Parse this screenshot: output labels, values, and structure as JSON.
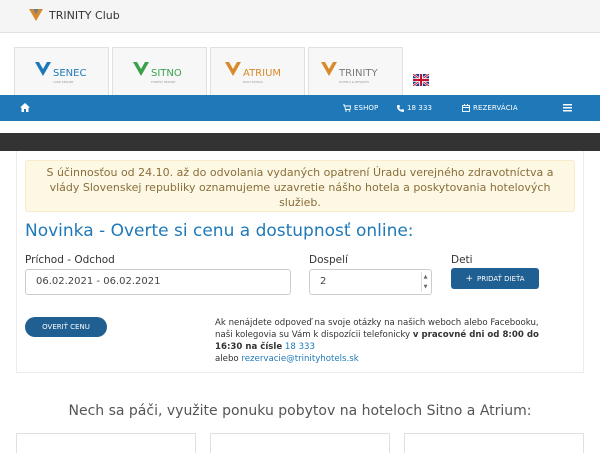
{
  "topbar": {
    "logo": "trinity-logo-icon",
    "title": "TRINITY Club"
  },
  "hotels": [
    {
      "name": "SENEC",
      "sub": "LAKE RESORT",
      "icon": "senec-logo-icon",
      "color": "#1f79b8"
    },
    {
      "name": "SITNO",
      "sub": "FOREST RESORT",
      "icon": "sitno-logo-icon",
      "color": "#3aa14b"
    },
    {
      "name": "ATRIUM",
      "sub": "HIGH TATRAS",
      "icon": "atrium-logo-icon",
      "color": "#d78a2a"
    },
    {
      "name": "TRINITY",
      "sub": "HOTELS & RESORTS",
      "icon": "trinity-hotels-logo-icon",
      "color": "#7a7a7a"
    }
  ],
  "nav": {
    "home_icon": "home-icon",
    "eshop": "ESHOP",
    "phone": "18 333",
    "reservation": "REZERVÁCIA",
    "menu_icon": "hamburger-icon",
    "language_icon": "uk-flag-icon"
  },
  "alert": {
    "text": "S účinnosťou od 24.10. až do odvolania vydaných opatrení Úradu verejného zdravotníctva a vlády Slovenskej republiky oznamujeme uzavretie nášho hotela a poskytovania hotelových služieb."
  },
  "form": {
    "heading": "Novinka - Overte si cenu a dostupnosť online:",
    "arrival_label": "Príchod - Odchod",
    "arrival_value": "06.02.2021 - 06.02.2021",
    "adults_label": "Dospelí",
    "adults_value": "2",
    "children_label": "Deti",
    "add_child_label": "PRIDAŤ DIEŤA",
    "check_price_label": "OVERIŤ CENU"
  },
  "info": {
    "line1": "Ak nenájdete odpoveď na svoje otázky na našich weboch alebo Facebooku,",
    "line2": "naši kolegovia su Vám k dispozícii telefonicky",
    "line2_bold": "v pracovné dni od 8:00 do",
    "line3_bold": "16:30 na čísle",
    "phone": "18 333",
    "line4": "alebo",
    "email": "rezervacie@trinityhotels.sk"
  },
  "offers": {
    "heading": "Nech sa páči, využite ponuku pobytov na hoteloch Sitno a Atrium:"
  },
  "colors": {
    "primary": "#1f79b8",
    "dark": "#333333",
    "alert_bg": "#fcf8e3",
    "alert_text": "#8a6d3b"
  }
}
